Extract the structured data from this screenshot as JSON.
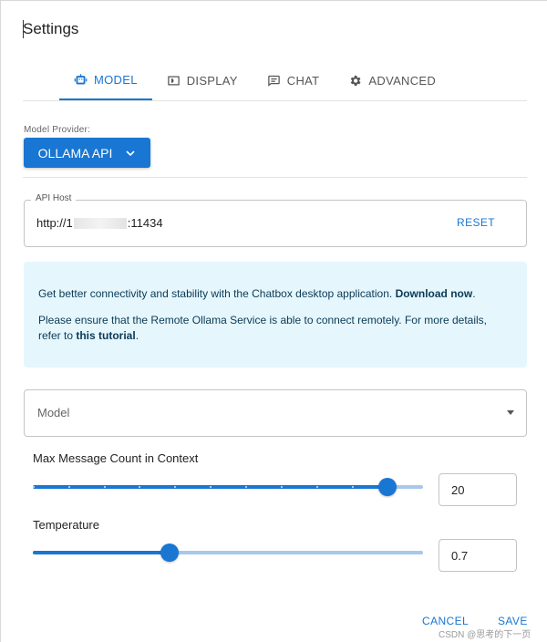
{
  "dialog": {
    "title": "Settings"
  },
  "tabs": [
    {
      "label": "MODEL",
      "icon": "robot-icon",
      "active": true
    },
    {
      "label": "DISPLAY",
      "icon": "display-icon",
      "active": false
    },
    {
      "label": "CHAT",
      "icon": "chat-icon",
      "active": false
    },
    {
      "label": "ADVANCED",
      "icon": "gear-icon",
      "active": false
    }
  ],
  "model_provider": {
    "label": "Model Provider:",
    "value": "OLLAMA API"
  },
  "api_host": {
    "legend": "API Host",
    "value_prefix": "http://1",
    "value_suffix": ":11434",
    "reset_label": "RESET"
  },
  "info": {
    "line1_text": "Get better connectivity and stability with the Chatbox desktop application.",
    "line1_link": "Download now",
    "line1_end": ".",
    "line2_text": "Please ensure that the Remote Ollama Service is able to connect remotely. For more details,",
    "line3_prefix": "refer to",
    "line3_link": "this tutorial",
    "line3_end": "."
  },
  "model_select": {
    "placeholder": "Model"
  },
  "max_messages": {
    "label": "Max Message Count in Context",
    "value": "20",
    "fraction": 0.91
  },
  "temperature": {
    "label": "Temperature",
    "value": "0.7",
    "fraction": 0.35
  },
  "footer": {
    "cancel_label": "CANCEL",
    "save_label": "SAVE"
  },
  "watermark": "CSDN @思考的下一页",
  "colors": {
    "accent": "#1976d2",
    "info_bg": "#e5f6fd",
    "track_light": "#a7c8eb"
  }
}
